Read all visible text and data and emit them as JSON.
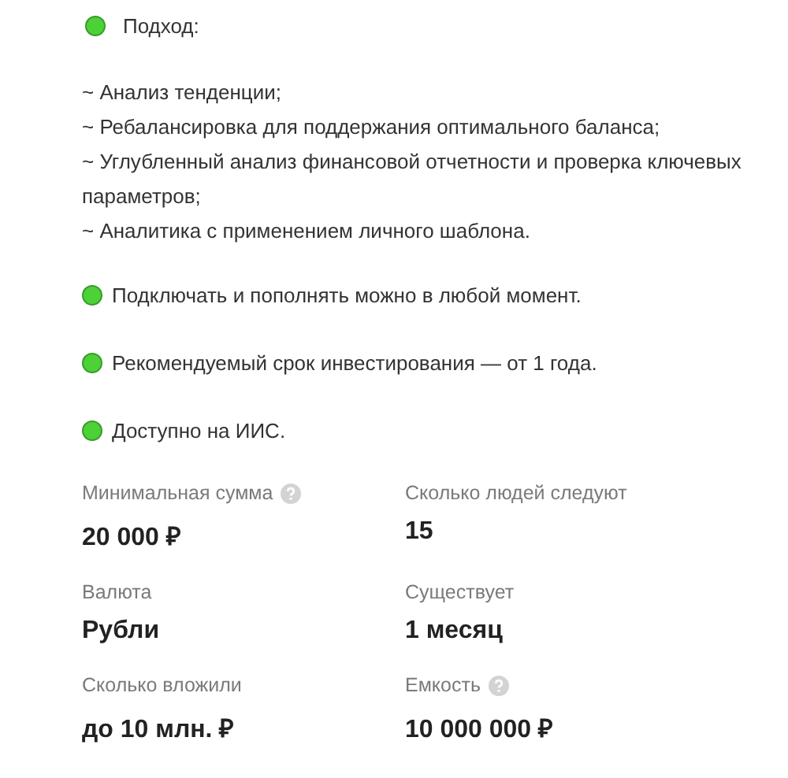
{
  "approach": {
    "title": "Подход:",
    "lines": [
      "~ Анализ тенденции;",
      "~ Ребалансировка для поддержания оптимального баланса;",
      "~ Углубленный анализ финансовой отчетности и проверка ключевых параметров;",
      "~ Аналитика с применением личного шаблона."
    ]
  },
  "notes": [
    "Подключать и пополнять можно в любой момент.",
    "Рекомендуемый срок инвестирования — от 1 года.",
    "Доступно на ИИС."
  ],
  "stats": [
    {
      "kind": "with_help",
      "label": "Минимальная сумма",
      "value": "20 000 ₽"
    },
    {
      "kind": "plain",
      "label": "Сколько людей следуют",
      "value": "15"
    },
    {
      "kind": "plain",
      "label": "Валюта",
      "value": "Рубли"
    },
    {
      "kind": "plain",
      "label": "Существует",
      "value": "1 месяц"
    },
    {
      "kind": "plain",
      "label": "Сколько вложили",
      "value": "до 10 млн. ₽"
    },
    {
      "kind": "with_help",
      "label": "Емкость",
      "value": "10 000 000 ₽"
    }
  ]
}
